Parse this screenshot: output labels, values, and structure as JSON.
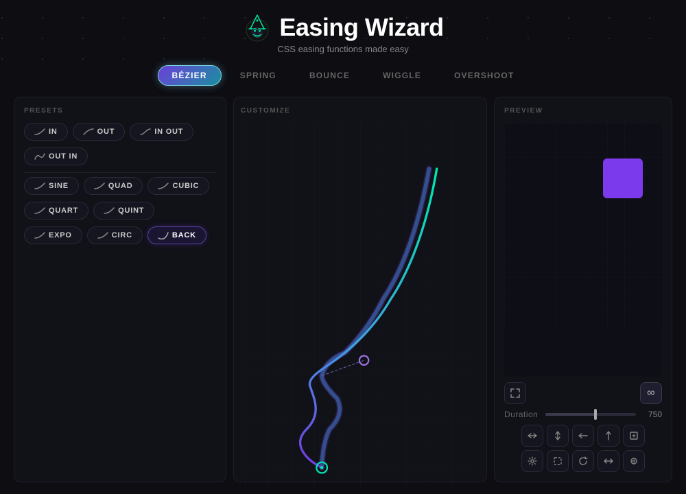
{
  "header": {
    "title": "Easing Wizard",
    "subtitle": "CSS easing functions made easy"
  },
  "nav": {
    "tabs": [
      {
        "id": "bezier",
        "label": "BÉZIER",
        "active": true
      },
      {
        "id": "spring",
        "label": "SPRING",
        "active": false
      },
      {
        "id": "bounce",
        "label": "BOUNCE",
        "active": false
      },
      {
        "id": "wiggle",
        "label": "WIGGLE",
        "active": false
      },
      {
        "id": "overshoot",
        "label": "OVERSHOOT",
        "active": false
      }
    ]
  },
  "presets": {
    "label": "PRESETS",
    "direction_group": [
      {
        "id": "in",
        "label": "IN",
        "active": false
      },
      {
        "id": "out",
        "label": "OUT",
        "active": false
      },
      {
        "id": "in-out",
        "label": "IN OUT",
        "active": false
      }
    ],
    "direction_group2": [
      {
        "id": "out-in",
        "label": "OUT IN",
        "active": false
      }
    ],
    "easing_group": [
      {
        "id": "sine",
        "label": "SINE",
        "active": false
      },
      {
        "id": "quad",
        "label": "QUAD",
        "active": false
      },
      {
        "id": "cubic",
        "label": "CUBIC",
        "active": false
      }
    ],
    "easing_group2": [
      {
        "id": "quart",
        "label": "QUART",
        "active": false
      },
      {
        "id": "quint",
        "label": "QUINT",
        "active": false
      }
    ],
    "easing_group3": [
      {
        "id": "expo",
        "label": "EXPO",
        "active": false
      },
      {
        "id": "circ",
        "label": "CIRC",
        "active": false
      },
      {
        "id": "back",
        "label": "BACK",
        "active": true
      }
    ]
  },
  "customize": {
    "label": "CUSTOMIZE"
  },
  "preview": {
    "label": "PREVIEW",
    "duration": {
      "label": "Duration",
      "value": "750",
      "slider_percent": 55
    },
    "actions_row1": [
      {
        "id": "expand",
        "symbol": "⤢"
      },
      {
        "id": "move-ud",
        "symbol": "↕"
      },
      {
        "id": "move-lr",
        "symbol": "↔"
      },
      {
        "id": "move-up",
        "symbol": "↑"
      },
      {
        "id": "fullscreen",
        "symbol": "⛶"
      }
    ],
    "actions_row2": [
      {
        "id": "settings",
        "symbol": "⚙"
      },
      {
        "id": "select",
        "symbol": "⬚"
      },
      {
        "id": "rotate",
        "symbol": "↻"
      },
      {
        "id": "flip",
        "symbol": "⇄"
      },
      {
        "id": "camera",
        "symbol": "⊙"
      }
    ]
  },
  "icons": {
    "wizard_hat": "🧙",
    "infinity": "∞",
    "expand_frame": "⤢"
  }
}
